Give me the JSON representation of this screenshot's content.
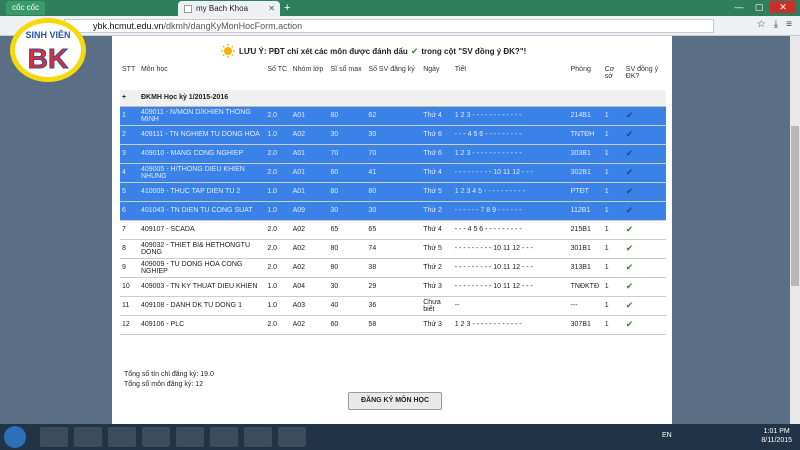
{
  "browser": {
    "brand": "cốc cốc",
    "tab_title": "my Bach Khoa",
    "url_host": "ybk.hcmut.edu.vn",
    "url_path": "/dkmh/dangKyMonHocForm.action"
  },
  "logo": {
    "line1": "SINH VIÊN",
    "line2": "BK"
  },
  "notice": {
    "prefix": "LƯU Ý: PĐT chỉ xét các môn được đánh dấu",
    "suffix": "trong cột \"SV đồng ý ĐK?\"!"
  },
  "table": {
    "headers": [
      "STT",
      "Môn học",
      "Số TC",
      "Nhóm lớp",
      "Sĩ số max",
      "Số SV đăng ký",
      "Ngày",
      "Tiết",
      "Phòng",
      "Cơ sở",
      "SV đồng ý ĐK?"
    ],
    "semester_label": "ĐKMH Học kỳ 1/2015-2016",
    "rows": [
      {
        "stt": "1",
        "course": "409011 - N/MON D/KHIEN THONG MINH",
        "tc": "2.0",
        "group": "A01",
        "max": "80",
        "reg": "62",
        "day": "Thứ 4",
        "period": "1 2 3 - - - - - - - - - - - -",
        "room": "214B1",
        "campus": "1",
        "agree": "✔",
        "selected": true
      },
      {
        "stt": "2",
        "course": "409111 - TN NGHIEM TU DONG HOA",
        "tc": "1.0",
        "group": "A02",
        "max": "30",
        "reg": "30",
        "day": "Thứ 6",
        "period": "- - - 4 5 6 - - - - - - - - -",
        "room": "TNTĐH",
        "campus": "1",
        "agree": "✔",
        "selected": true
      },
      {
        "stt": "3",
        "course": "409010 - MANG CONG NGHIEP",
        "tc": "2.0",
        "group": "A01",
        "max": "70",
        "reg": "70",
        "day": "Thứ 6",
        "period": "1 2 3 - - - - - - - - - - - -",
        "room": "303B1",
        "campus": "1",
        "agree": "✔",
        "selected": true
      },
      {
        "stt": "4",
        "course": "409005 - H/THONG DIEU KHIEN NHUNG",
        "tc": "2.0",
        "group": "A01",
        "max": "60",
        "reg": "41",
        "day": "Thứ 4",
        "period": "- - - - - - - - - 10 11 12 - - -",
        "room": "302B1",
        "campus": "1",
        "agree": "✔",
        "selected": true
      },
      {
        "stt": "5",
        "course": "410009 - THUC TAP DIEN TU 2",
        "tc": "1.0",
        "group": "A01",
        "max": "80",
        "reg": "80",
        "day": "Thứ 5",
        "period": "1 2 3 4 5 - - - - - - - - - -",
        "room": "PTĐT",
        "campus": "1",
        "agree": "✔",
        "selected": true
      },
      {
        "stt": "6",
        "course": "401043 - TN DIEN TU CONG SUAT",
        "tc": "1.0",
        "group": "A09",
        "max": "30",
        "reg": "30",
        "day": "Thứ 2",
        "period": "- - - - - - 7 8 9 - - - - - -",
        "room": "112B1",
        "campus": "1",
        "agree": "✔",
        "selected": true
      },
      {
        "stt": "7",
        "course": "409107 - SCADA",
        "tc": "2.0",
        "group": "A02",
        "max": "65",
        "reg": "65",
        "day": "Thứ 4",
        "period": "- - - 4 5 6 - - - - - - - - -",
        "room": "215B1",
        "campus": "1",
        "agree": "✔",
        "selected": false
      },
      {
        "stt": "8",
        "course": "409032 - THIET BI& HETHONGTU DONG",
        "tc": "2.0",
        "group": "A02",
        "max": "80",
        "reg": "74",
        "day": "Thứ 5",
        "period": "- - - - - - - - - 10 11 12 - - -",
        "room": "301B1",
        "campus": "1",
        "agree": "✔",
        "selected": false
      },
      {
        "stt": "9",
        "course": "409009 - TU DONG HOA CONG NGHIEP",
        "tc": "2.0",
        "group": "A02",
        "max": "80",
        "reg": "38",
        "day": "Thứ 2",
        "period": "- - - - - - - - - 10 11 12 - - -",
        "room": "313B1",
        "campus": "1",
        "agree": "✔",
        "selected": false
      },
      {
        "stt": "10",
        "course": "409003 - TN KY THUAT DIEU KHIEN",
        "tc": "1.0",
        "group": "A04",
        "max": "30",
        "reg": "29",
        "day": "Thứ 3",
        "period": "- - - - - - - - - 10 11 12 - - -",
        "room": "TNĐKTĐ",
        "campus": "1",
        "agree": "✔",
        "selected": false
      },
      {
        "stt": "11",
        "course": "409108 - DANH DK TU DONG 1",
        "tc": "1.0",
        "group": "A03",
        "max": "40",
        "reg": "36",
        "day": "Chưa biết",
        "period": "--",
        "room": "---",
        "campus": "1",
        "agree": "✔",
        "selected": false
      },
      {
        "stt": "12",
        "course": "409106 - PLC",
        "tc": "2.0",
        "group": "A02",
        "max": "60",
        "reg": "58",
        "day": "Thứ 3",
        "period": "1 2 3 - - - - - - - - - - - -",
        "room": "307B1",
        "campus": "1",
        "agree": "✔",
        "selected": false
      }
    ]
  },
  "summary": {
    "credits": "Tổng số tín chỉ đăng ký: 19.0",
    "courses": "Tổng số môn đăng ký: 12"
  },
  "submit_label": "ĐĂNG KÝ MÔN HỌC",
  "taskbar": {
    "lang": "EN",
    "time": "1:01 PM",
    "date": "8/11/2015"
  }
}
